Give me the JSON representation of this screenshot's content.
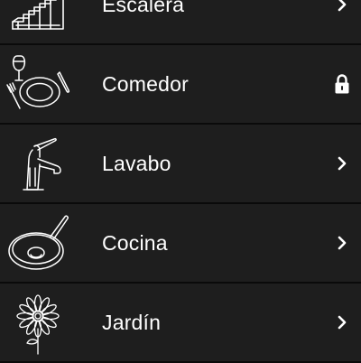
{
  "list": {
    "items": [
      {
        "label": "Escalera",
        "icon": "stairs-icon",
        "accessory": "chevron-right-icon"
      },
      {
        "label": "Comedor",
        "icon": "dinner-plate-icon",
        "accessory": "lock-icon"
      },
      {
        "label": "Lavabo",
        "icon": "faucet-icon",
        "accessory": "chevron-right-icon"
      },
      {
        "label": "Cocina",
        "icon": "frying-pan-icon",
        "accessory": "chevron-right-icon"
      },
      {
        "label": "Jardín",
        "icon": "flower-icon",
        "accessory": "chevron-right-icon"
      }
    ]
  },
  "colors": {
    "background": "#1e1e1e",
    "separator": "#0a0a0a",
    "text": "#ffffff",
    "icon_stroke": "#ffffff"
  }
}
